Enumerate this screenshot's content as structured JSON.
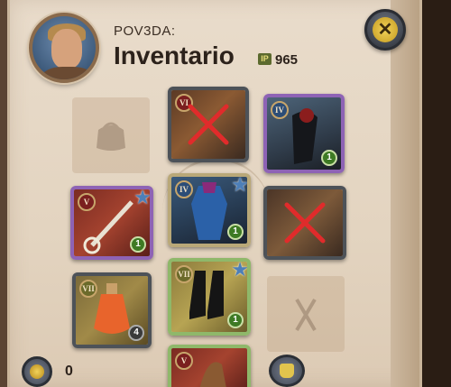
{
  "header": {
    "player_name": "POV3DA:",
    "title": "Inventario",
    "ip_badge": "IP",
    "ip_value": "965"
  },
  "close_icon_glyph": "✕",
  "slots": [
    {
      "id": "head",
      "tier": "VI",
      "qty": "",
      "broken": true,
      "star": false,
      "quality": "gray"
    },
    {
      "id": "cape",
      "tier": "IV",
      "qty": "1",
      "broken": false,
      "star": false,
      "quality": "purple"
    },
    {
      "id": "main-hand",
      "tier": "V",
      "qty": "1",
      "broken": false,
      "star": true,
      "quality": "purple"
    },
    {
      "id": "armor",
      "tier": "IV",
      "qty": "1",
      "broken": false,
      "star": true,
      "quality": "gray"
    },
    {
      "id": "off-hand",
      "tier": "",
      "qty": "",
      "broken": true,
      "star": false,
      "quality": "gray"
    },
    {
      "id": "potion",
      "tier": "VII",
      "qty": "4",
      "broken": false,
      "star": false,
      "quality": "gray"
    },
    {
      "id": "shoes",
      "tier": "VII",
      "qty": "1",
      "broken": false,
      "star": true,
      "quality": "green"
    },
    {
      "id": "mount",
      "tier": "V",
      "qty": "",
      "broken": false,
      "star": false,
      "quality": "green"
    }
  ],
  "footer": {
    "silver_value": "0"
  },
  "colors": {
    "panel": "#e9dccb",
    "broken_mark": "#e02b2b",
    "gold": "#f1d25a"
  }
}
